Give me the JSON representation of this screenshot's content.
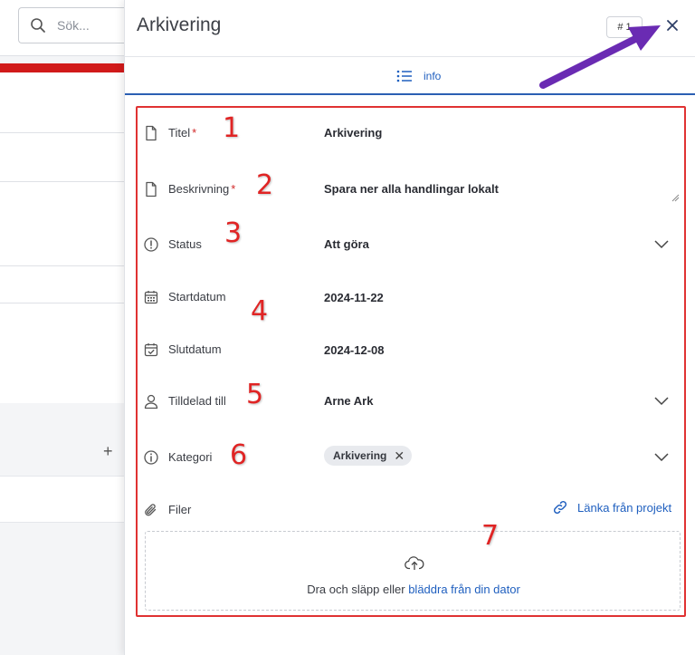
{
  "background": {
    "search_placeholder": "Sök...",
    "add_glyph": "+"
  },
  "panel": {
    "title": "Arkivering",
    "badge": "# 1",
    "close_icon": "close-icon",
    "tab_label": "info"
  },
  "fields": {
    "titel": {
      "label": "Titel",
      "required_mark": "*",
      "value": "Arkivering"
    },
    "beskrivning": {
      "label": "Beskrivning",
      "required_mark": "*",
      "value": "Spara ner alla handlingar lokalt"
    },
    "status": {
      "label": "Status",
      "value": "Att göra"
    },
    "startdatum": {
      "label": "Startdatum",
      "value": "2024-11-22"
    },
    "slutdatum": {
      "label": "Slutdatum",
      "value": "2024-12-08"
    },
    "tilldelad": {
      "label": "Tilldelad till",
      "value": "Arne Ark"
    },
    "kategori": {
      "label": "Kategori",
      "tag": "Arkivering",
      "remove_glyph": "✕"
    },
    "filer": {
      "label": "Filer",
      "link_label": "Länka från projekt"
    }
  },
  "dropzone": {
    "text": "Dra och släpp eller",
    "link": "bläddra från din dator"
  },
  "annotations": [
    "1",
    "2",
    "3",
    "4",
    "5",
    "6",
    "7"
  ],
  "colors": {
    "accent": "#1f5fbf",
    "annotation_red": "#e02424",
    "arrow_purple": "#6a2bb3",
    "required": "#d12a2a"
  }
}
